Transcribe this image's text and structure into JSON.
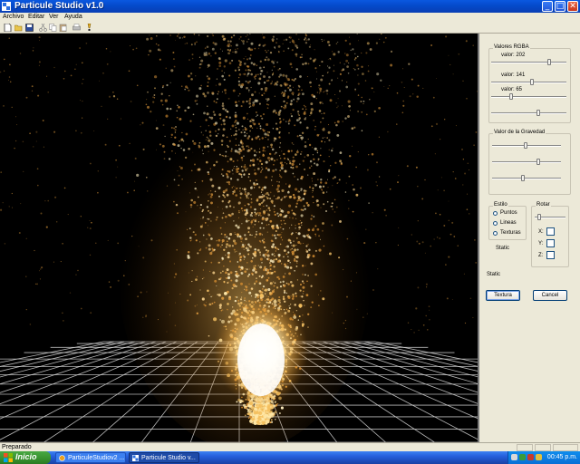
{
  "window": {
    "title": "Particule Studio v1.0",
    "minimize_icon": "minimize-icon",
    "maximize_icon": "maximize-icon",
    "close_icon": "close-icon"
  },
  "menu": [
    {
      "label": "Archivo"
    },
    {
      "label": "Editar"
    },
    {
      "label": "Ver"
    },
    {
      "label": "Ayuda"
    }
  ],
  "toolbar": {
    "icons": [
      "new-file-icon",
      "open-folder-icon",
      "save-icon",
      "cut-icon",
      "copy-icon",
      "paste-icon",
      "print-icon",
      "help-icon"
    ]
  },
  "panel": {
    "rgba": {
      "legend": "Valores RGBA",
      "sliders": [
        {
          "label": "valor: 202",
          "value": 202,
          "max": 255
        },
        {
          "label": "valor: 141",
          "value": 141,
          "max": 255
        },
        {
          "label": "valor: 65",
          "value": 65,
          "max": 255
        },
        {
          "label": "",
          "value": 160,
          "max": 255
        }
      ]
    },
    "gravity": {
      "legend": "Valor de la Gravedad",
      "sliders": [
        {
          "value": 0.48
        },
        {
          "value": 0.68
        },
        {
          "value": 0.44
        }
      ]
    },
    "style": {
      "legend": "Estilo",
      "options": [
        {
          "label": "Puntos",
          "selected": false
        },
        {
          "label": "Lineas",
          "selected": false
        },
        {
          "label": "Texturas",
          "selected": false
        }
      ],
      "static_label": "Static"
    },
    "rotate": {
      "legend": "Rotar",
      "slider_value": 0.1,
      "axes": [
        {
          "label": "X:",
          "checked": false
        },
        {
          "label": "Y:",
          "checked": false
        },
        {
          "label": "Z:",
          "checked": false
        }
      ]
    },
    "static_label": "Static",
    "texture_button": "Textura",
    "cancel_button": "Cancel"
  },
  "status": {
    "text": "Preparado"
  },
  "taskbar": {
    "start_label": "Inicio",
    "tasks": [
      {
        "label": "ParticuleStudiov2 ...",
        "active": false
      },
      {
        "label": "Particule Studio v...",
        "active": true
      }
    ],
    "clock": "00:45 p.m."
  },
  "colors": {
    "particle_core": "#fff7d0",
    "particle_glow": "#f0b24a",
    "grid": "#d8d8d8",
    "background": "#000000"
  }
}
